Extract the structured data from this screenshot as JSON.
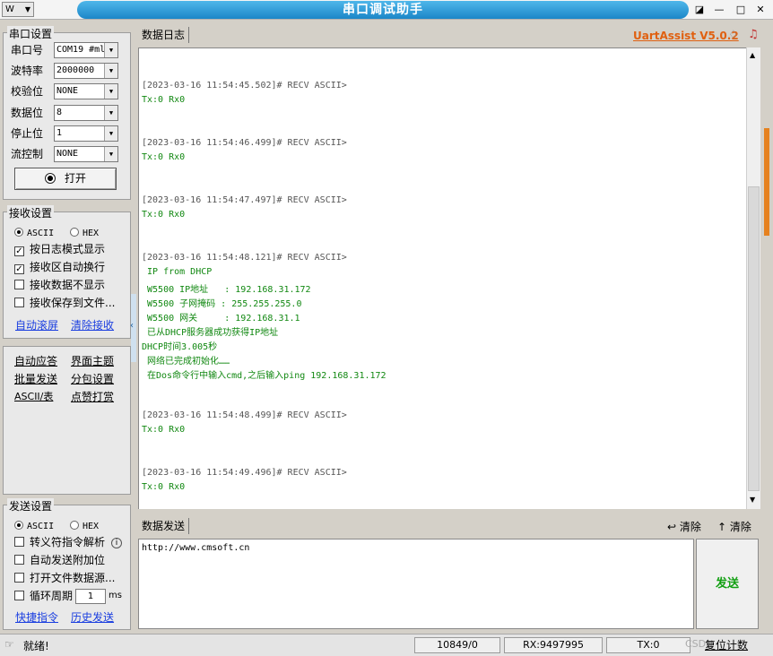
{
  "title_bar": {
    "app_menu_label": "W",
    "title": "串口调试助手",
    "pin_glyph": "◪",
    "minimize_glyph": "—",
    "maximize_glyph": "□",
    "close_glyph": "✕"
  },
  "serial_settings": {
    "group_label": "串口设置",
    "fields": [
      {
        "label": "串口号",
        "value": "COM19 #ml"
      },
      {
        "label": "波特率",
        "value": "2000000"
      },
      {
        "label": "校验位",
        "value": "NONE"
      },
      {
        "label": "数据位",
        "value": "8"
      },
      {
        "label": "停止位",
        "value": "1"
      },
      {
        "label": "流控制",
        "value": "NONE"
      }
    ],
    "open_button_label": "打开"
  },
  "receive_settings": {
    "group_label": "接收设置",
    "mode_ascii": "ASCII",
    "mode_hex": "HEX",
    "selected_mode": "ASCII",
    "options": [
      {
        "label": "按日志模式显示",
        "checked": true
      },
      {
        "label": "接收区自动换行",
        "checked": true
      },
      {
        "label": "接收数据不显示",
        "checked": false
      },
      {
        "label": "接收保存到文件...",
        "checked": false
      }
    ],
    "auto_scroll_link": "自动滚屏",
    "clear_receive_link": "清除接收"
  },
  "tool_links": {
    "row1": [
      "自动应答",
      "界面主题"
    ],
    "row2": [
      "批量发送",
      "分包设置"
    ],
    "row3": [
      "ASCII/表",
      "点赞打赏"
    ]
  },
  "send_settings": {
    "group_label": "发送设置",
    "mode_ascii": "ASCII",
    "mode_hex": "HEX",
    "selected_mode": "ASCII",
    "options": [
      {
        "label": "转义符指令解析",
        "checked": false
      },
      {
        "label": "自动发送附加位",
        "checked": false
      },
      {
        "label": "打开文件数据源...",
        "checked": false
      },
      {
        "label": "循环周期",
        "checked": false
      }
    ],
    "cycle_value": "1",
    "cycle_unit": "ms",
    "quick_commands_link": "快捷指令",
    "history_link": "历史发送"
  },
  "log_panel": {
    "tab_label": "数据日志",
    "brand": "UartAssist V5.0.2",
    "lines": [
      {
        "text": "[2023-03-16 11:54:45.502]# RECV ASCII>",
        "kind": "ts"
      },
      {
        "text": "Tx:0 Rx0",
        "kind": "gr"
      },
      {
        "text": "[2023-03-16 11:54:46.499]# RECV ASCII>",
        "kind": "ts"
      },
      {
        "text": "Tx:0 Rx0",
        "kind": "gr"
      },
      {
        "text": "[2023-03-16 11:54:47.497]# RECV ASCII>",
        "kind": "ts"
      },
      {
        "text": "Tx:0 Rx0",
        "kind": "gr"
      },
      {
        "text": "[2023-03-16 11:54:48.121]# RECV ASCII>",
        "kind": "ts"
      },
      {
        "text": " IP from DHCP",
        "kind": "gr"
      },
      {
        "text": " W5500 IP地址   : 192.168.31.172",
        "kind": "gr"
      },
      {
        "text": " W5500 子网掩码 : 255.255.255.0",
        "kind": "gr"
      },
      {
        "text": " W5500 网关     : 192.168.31.1",
        "kind": "gr"
      },
      {
        "text": " 已从DHCP服务器成功获得IP地址",
        "kind": "gr"
      },
      {
        "text": "DHCP时间3.005秒",
        "kind": "gr"
      },
      {
        "text": " 网络已完成初始化……",
        "kind": "gr"
      },
      {
        "text": " 在Dos命令行中输入cmd,之后输入ping 192.168.31.172",
        "kind": "gr"
      },
      {
        "text": "[2023-03-16 11:54:48.499]# RECV ASCII>",
        "kind": "ts"
      },
      {
        "text": "Tx:0 Rx0",
        "kind": "gr"
      },
      {
        "text": "[2023-03-16 11:54:49.496]# RECV ASCII>",
        "kind": "ts"
      },
      {
        "text": "Tx:0 Rx0",
        "kind": "gr"
      }
    ]
  },
  "send_panel": {
    "tab_label": "数据发送",
    "clear_label_1": "清除",
    "clear_label_2": "清除",
    "input_value": "http://www.cmsoft.cn",
    "send_button_label": "发送"
  },
  "status_bar": {
    "ready_text": "就绪!",
    "counter": "10849/0",
    "rx": "RX:9497995",
    "tx": "TX:0",
    "reset_label": "复位计数",
    "watermark": "CSDN"
  }
}
